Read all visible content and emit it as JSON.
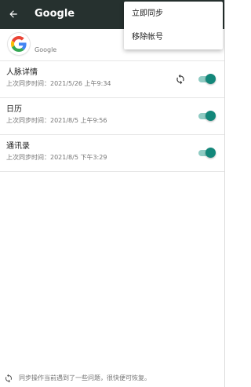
{
  "app_bar": {
    "title": "Google",
    "back_icon": "arrow-back-icon"
  },
  "account": {
    "logo_icon": "google-logo-icon",
    "label": "Google"
  },
  "sync_items": [
    {
      "title": "人脉详情",
      "subtitle": "上次同步时间：2021/5/26 上午9:34",
      "syncing": true,
      "enabled": true
    },
    {
      "title": "日历",
      "subtitle": "上次同步时间：2021/8/5 上午9:56",
      "syncing": false,
      "enabled": true
    },
    {
      "title": "通讯录",
      "subtitle": "上次同步时间：2021/8/5 下午3:29",
      "syncing": false,
      "enabled": true
    }
  ],
  "menu": {
    "items": [
      {
        "label": "立即同步"
      },
      {
        "label": "移除帐号"
      }
    ]
  },
  "footer": {
    "icon": "sync-problem-icon",
    "text": "同步操作当前遇到了一些问题，很快便可恢复。"
  },
  "colors": {
    "app_bar": "#26312f",
    "switch_thumb": "#13877a",
    "switch_track": "#8fcbc3"
  }
}
